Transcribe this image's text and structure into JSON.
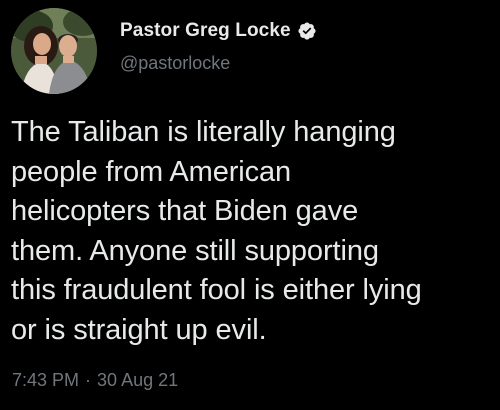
{
  "tweet": {
    "author": {
      "display_name": "Pastor Greg Locke",
      "handle": "@pastorlocke",
      "verified": true,
      "avatar_icon": "profile-photo-couple"
    },
    "text": "The Taliban is literally hanging\npeople from American\nhelicopters that Biden gave\nthem. Anyone still supporting\nthis fraudulent fool is either lying\nor is straight up evil.",
    "time": "7:43 PM",
    "separator": "·",
    "date": "30 Aug 21"
  },
  "colors": {
    "background": "#000000",
    "primary_text": "#e7e9ea",
    "secondary_text": "#71767b",
    "verified_badge": "#e7e9ea"
  }
}
